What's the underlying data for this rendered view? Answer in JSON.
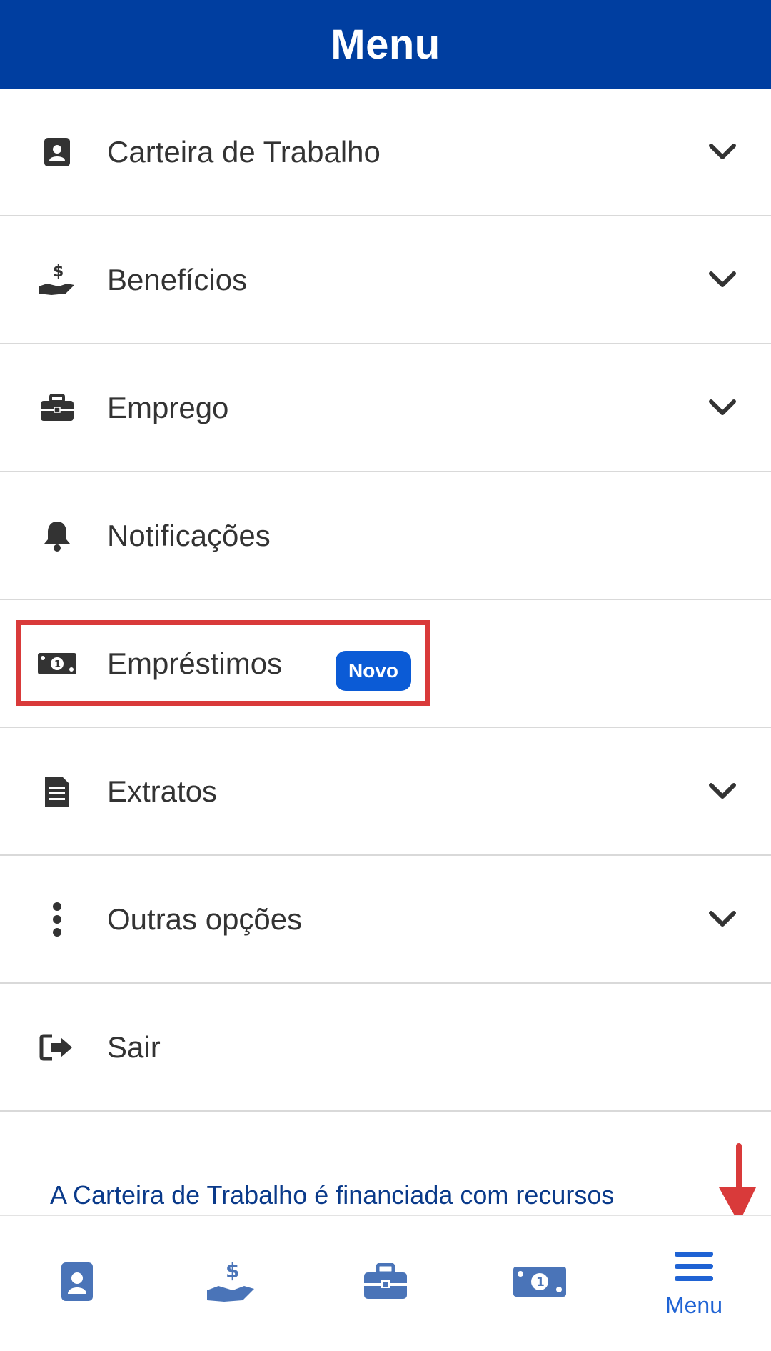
{
  "header": {
    "title": "Menu"
  },
  "menu": {
    "items": [
      {
        "label": "Carteira de Trabalho",
        "icon": "id-card-icon",
        "expandable": true
      },
      {
        "label": "Benefícios",
        "icon": "hand-dollar-icon",
        "expandable": true
      },
      {
        "label": "Emprego",
        "icon": "briefcase-icon",
        "expandable": true
      },
      {
        "label": "Notificações",
        "icon": "bell-icon",
        "expandable": false
      },
      {
        "label": "Empréstimos",
        "icon": "money-bill-icon",
        "expandable": false,
        "badge": "Novo"
      },
      {
        "label": "Extratos",
        "icon": "document-icon",
        "expandable": true
      },
      {
        "label": "Outras opções",
        "icon": "vertical-dots-icon",
        "expandable": true
      },
      {
        "label": "Sair",
        "icon": "sign-out-icon",
        "expandable": false
      }
    ]
  },
  "footer": {
    "text": "A Carteira de Trabalho é financiada com recursos"
  },
  "bottom_nav": {
    "items": [
      {
        "icon": "id-card-icon"
      },
      {
        "icon": "hand-dollar-icon"
      },
      {
        "icon": "briefcase-icon"
      },
      {
        "icon": "money-bill-icon"
      },
      {
        "icon": "hamburger-menu-icon",
        "label": "Menu"
      }
    ]
  },
  "colors": {
    "header_bg": "#003ea0",
    "badge_bg": "#0b5bd6",
    "nav_icon": "#4a74b8",
    "nav_active": "#1f63d4",
    "highlight": "#d93a3a",
    "footer_text": "#0a3a8a"
  }
}
